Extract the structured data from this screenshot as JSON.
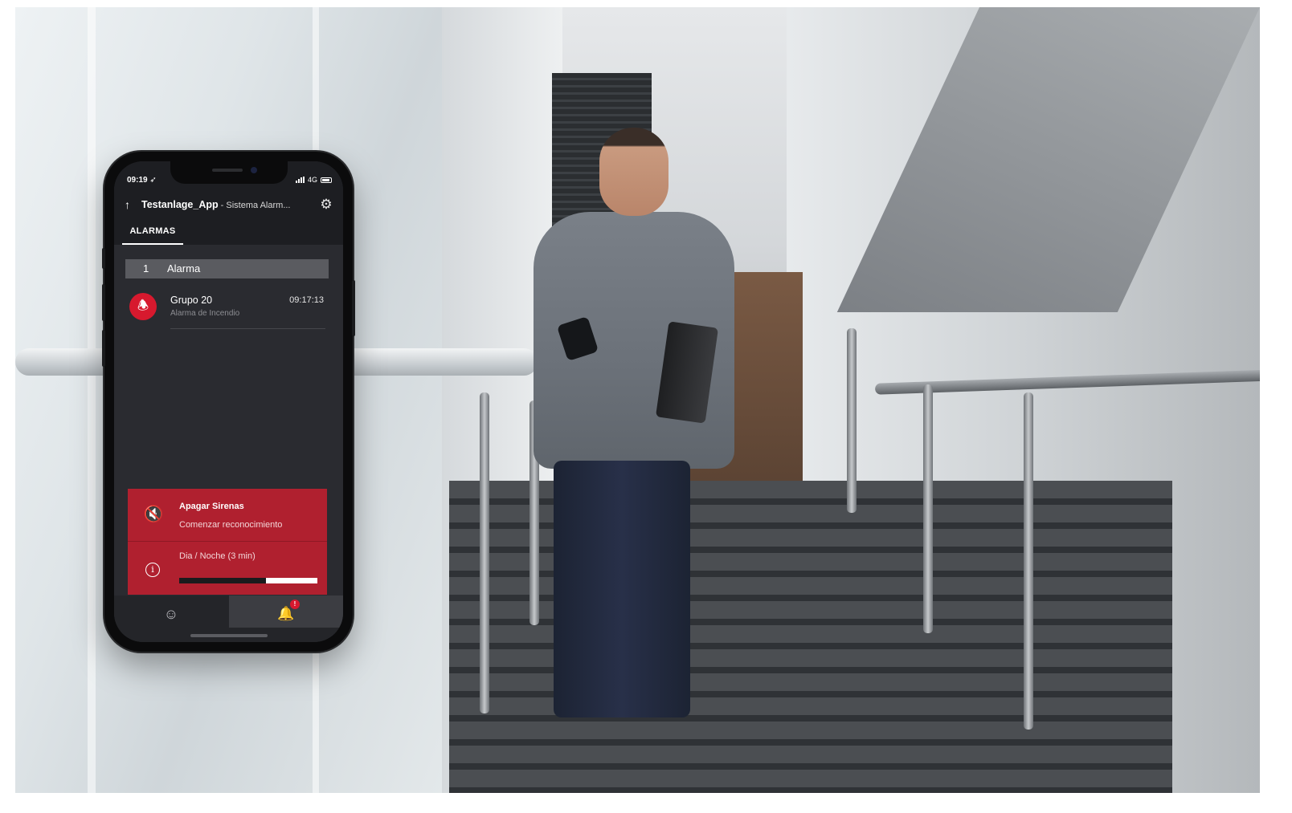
{
  "status_bar": {
    "time": "09:19 ➶",
    "network": "4G"
  },
  "header": {
    "title_main": "Testanlage_App",
    "title_separator": " - ",
    "title_sub": "Sistema Alarm...",
    "tab_label": "ALARMAS"
  },
  "alarms": {
    "count": "1",
    "count_label": "Alarma",
    "items": [
      {
        "name": "Grupo 20",
        "type": "Alarma de Incendio",
        "time": "09:17:13"
      }
    ]
  },
  "actions": {
    "silence_title": "Apagar Sirenas",
    "silence_subtitle": "Comenzar reconocimiento",
    "day_night_label": "Dia / Noche (3 min)",
    "day_night_progress": 0.63
  },
  "bottom_nav": {
    "badge_count": "!"
  },
  "colors": {
    "accent_red": "#b0202f",
    "alarm_red": "#d7192e",
    "screen_bg": "#2a2b30"
  },
  "icons": [
    "back-arrow-icon",
    "gear-icon",
    "fire-alarm-icon",
    "siren-off-icon",
    "info-icon",
    "user-icon",
    "bell-icon"
  ]
}
